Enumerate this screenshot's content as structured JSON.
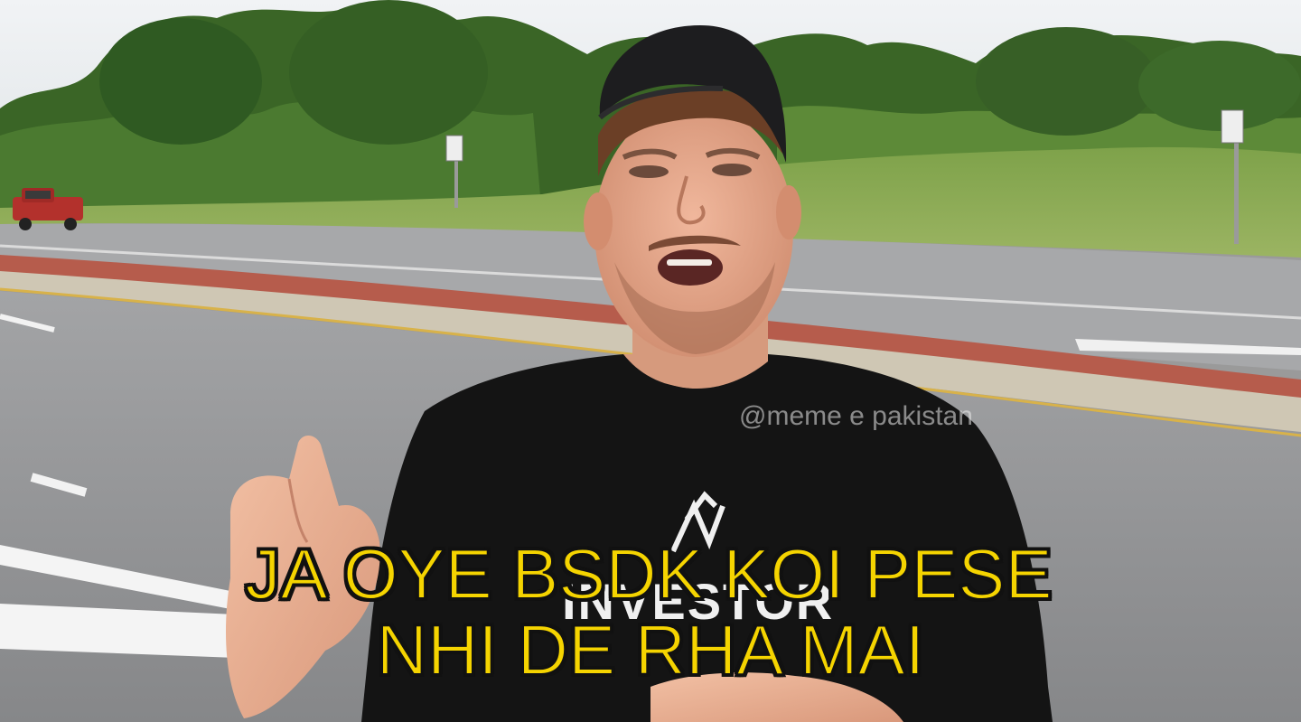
{
  "watermark": "@meme e pakistan",
  "caption": {
    "line1": "JA OYE BSDK KOI PESE",
    "line2": "NHI DE RHA MAI"
  },
  "shirt_text": "INVESTOR",
  "colors": {
    "caption_fill": "#f5d400",
    "caption_outline": "#111111",
    "sky": "#e9ecef",
    "trees": "#3f6b2a",
    "road": "#8f9092",
    "median_red": "#b35a4a",
    "shirt": "#141414",
    "cap": "#1d1d1f",
    "skin": "#e2a487",
    "car": "#b3312c"
  }
}
